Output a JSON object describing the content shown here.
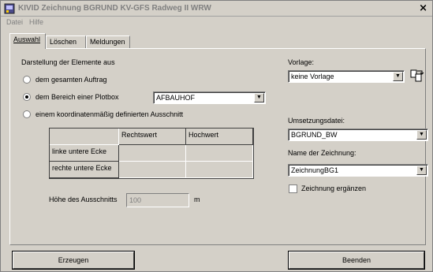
{
  "window": {
    "title": "KIVID Zeichnung BGRUND KV-GFS Radweg II WRW",
    "close_glyph": "×"
  },
  "menu": [
    {
      "label": "Datei"
    },
    {
      "label": "Hilfe"
    }
  ],
  "tabs": [
    {
      "label": "Auswahl",
      "active": true
    },
    {
      "label": "Löschen",
      "active": false
    },
    {
      "label": "Meldungen",
      "active": false
    }
  ],
  "left": {
    "group_label": "Darstellung der Elemente aus",
    "radio_auftrag": {
      "label": "dem gesamten Auftrag",
      "checked": false
    },
    "radio_plotbox": {
      "label": "dem Bereich einer Plotbox",
      "checked": true
    },
    "plotbox_combo": {
      "value": "AFBAUHOF"
    },
    "radio_ausschnitt": {
      "label": "einem koordinatenmäßig definierten Ausschnitt",
      "checked": false
    },
    "grid": {
      "columns": [
        "Rechtswert",
        "Hochwert"
      ],
      "rows": [
        "linke untere Ecke",
        "rechte untere Ecke"
      ]
    },
    "hoehe_label": "Höhe des Ausschnitts",
    "hoehe_value": "100",
    "hoehe_unit": "m"
  },
  "right": {
    "vorlage_label": "Vorlage:",
    "vorlage_value": "keine Vorlage",
    "umsetzung_label": "Umsetzungsdatei:",
    "umsetzung_value": "BGRUND_BW",
    "name_label": "Name der Zeichnung:",
    "name_value": "ZeichnungBG1",
    "ergaenzen_label": "Zeichnung ergänzen",
    "ergaenzen_checked": false
  },
  "buttons": {
    "erzeugen": "Erzeugen",
    "beenden": "Beenden"
  },
  "icons": {
    "app": "app-window-icon",
    "vorlage_tool": "copy-template-icon"
  }
}
